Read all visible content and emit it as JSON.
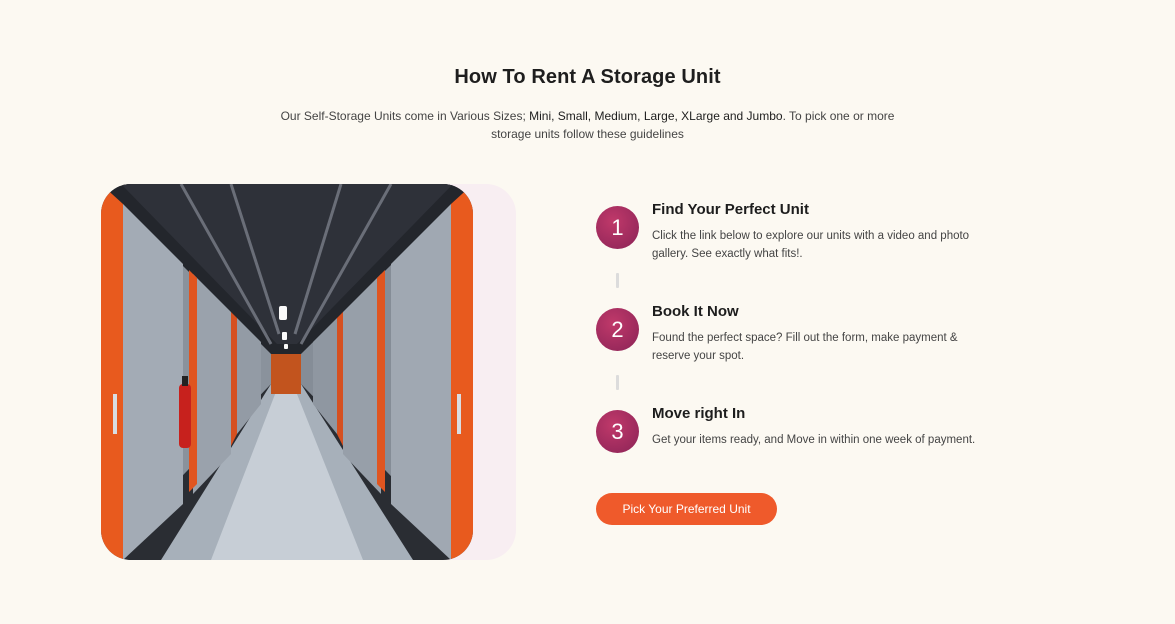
{
  "section": {
    "title": "How To Rent A Storage Unit",
    "subtitle_part1": "Our Self-Storage Units come in Various Sizes; ",
    "subtitle_sizes": "Mini, Small, Medium, Large, XLarge and Jumbo",
    "subtitle_part2": ". To pick one or more storage units follow these guidelines"
  },
  "photo": {
    "subject": "storage-corridor"
  },
  "steps": [
    {
      "number": "1",
      "title": "Find Your Perfect Unit",
      "description": "Click the link below to explore our units with a video and photo gallery. See exactly what fits!."
    },
    {
      "number": "2",
      "title": "Book It Now",
      "description": "Found the perfect space? Fill out the form, make payment & reserve your spot."
    },
    {
      "number": "3",
      "title": "Move right In",
      "description": "Get your items ready, and Move in within one week of payment."
    }
  ],
  "cta": {
    "label": "Pick Your Preferred Unit"
  },
  "colors": {
    "accent": "#ef5a2b",
    "step_circle": "#a02d5e",
    "background": "#fcf9f2"
  }
}
